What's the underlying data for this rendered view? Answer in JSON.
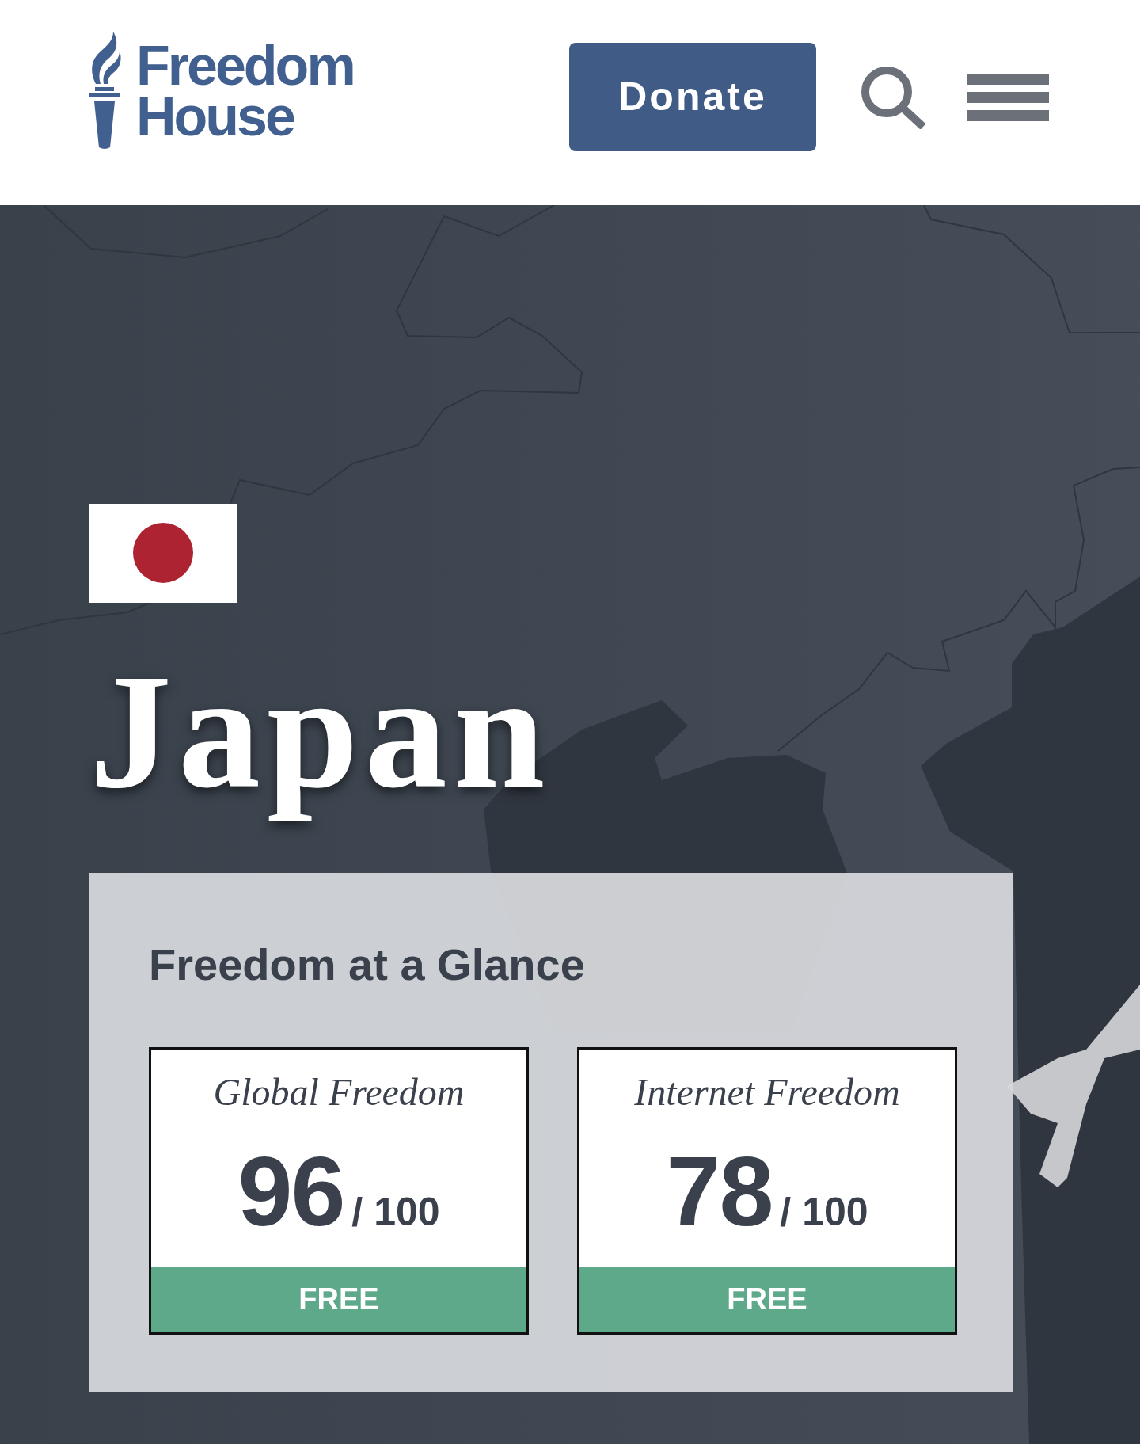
{
  "header": {
    "logo_lines": [
      "Freedom",
      "House"
    ],
    "donate_button": "Donate"
  },
  "hero": {
    "country": "Japan"
  },
  "freedom_at_a_glance": {
    "title": "Freedom at a Glance",
    "scores": [
      {
        "label": "Global Freedom",
        "score": "96",
        "out_of": "/ 100",
        "status": "FREE"
      },
      {
        "label": "Internet Freedom",
        "score": "78",
        "out_of": "/ 100",
        "status": "FREE"
      }
    ]
  }
}
